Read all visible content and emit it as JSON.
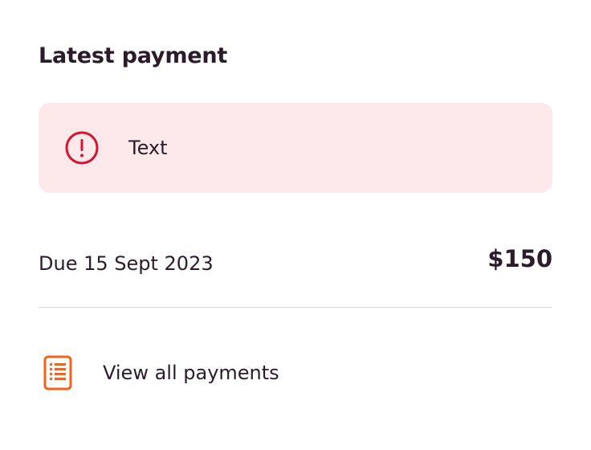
{
  "section": {
    "title": "Latest payment"
  },
  "alert": {
    "text": "Text",
    "icon": "exclamation-circle-icon",
    "background_color": "#fde8ea",
    "icon_color": "#d6142e"
  },
  "payment": {
    "due_label": "Due 15 Sept 2023",
    "amount": "$150"
  },
  "link": {
    "label": "View all payments",
    "icon": "document-list-icon",
    "icon_color": "#f0641e"
  }
}
